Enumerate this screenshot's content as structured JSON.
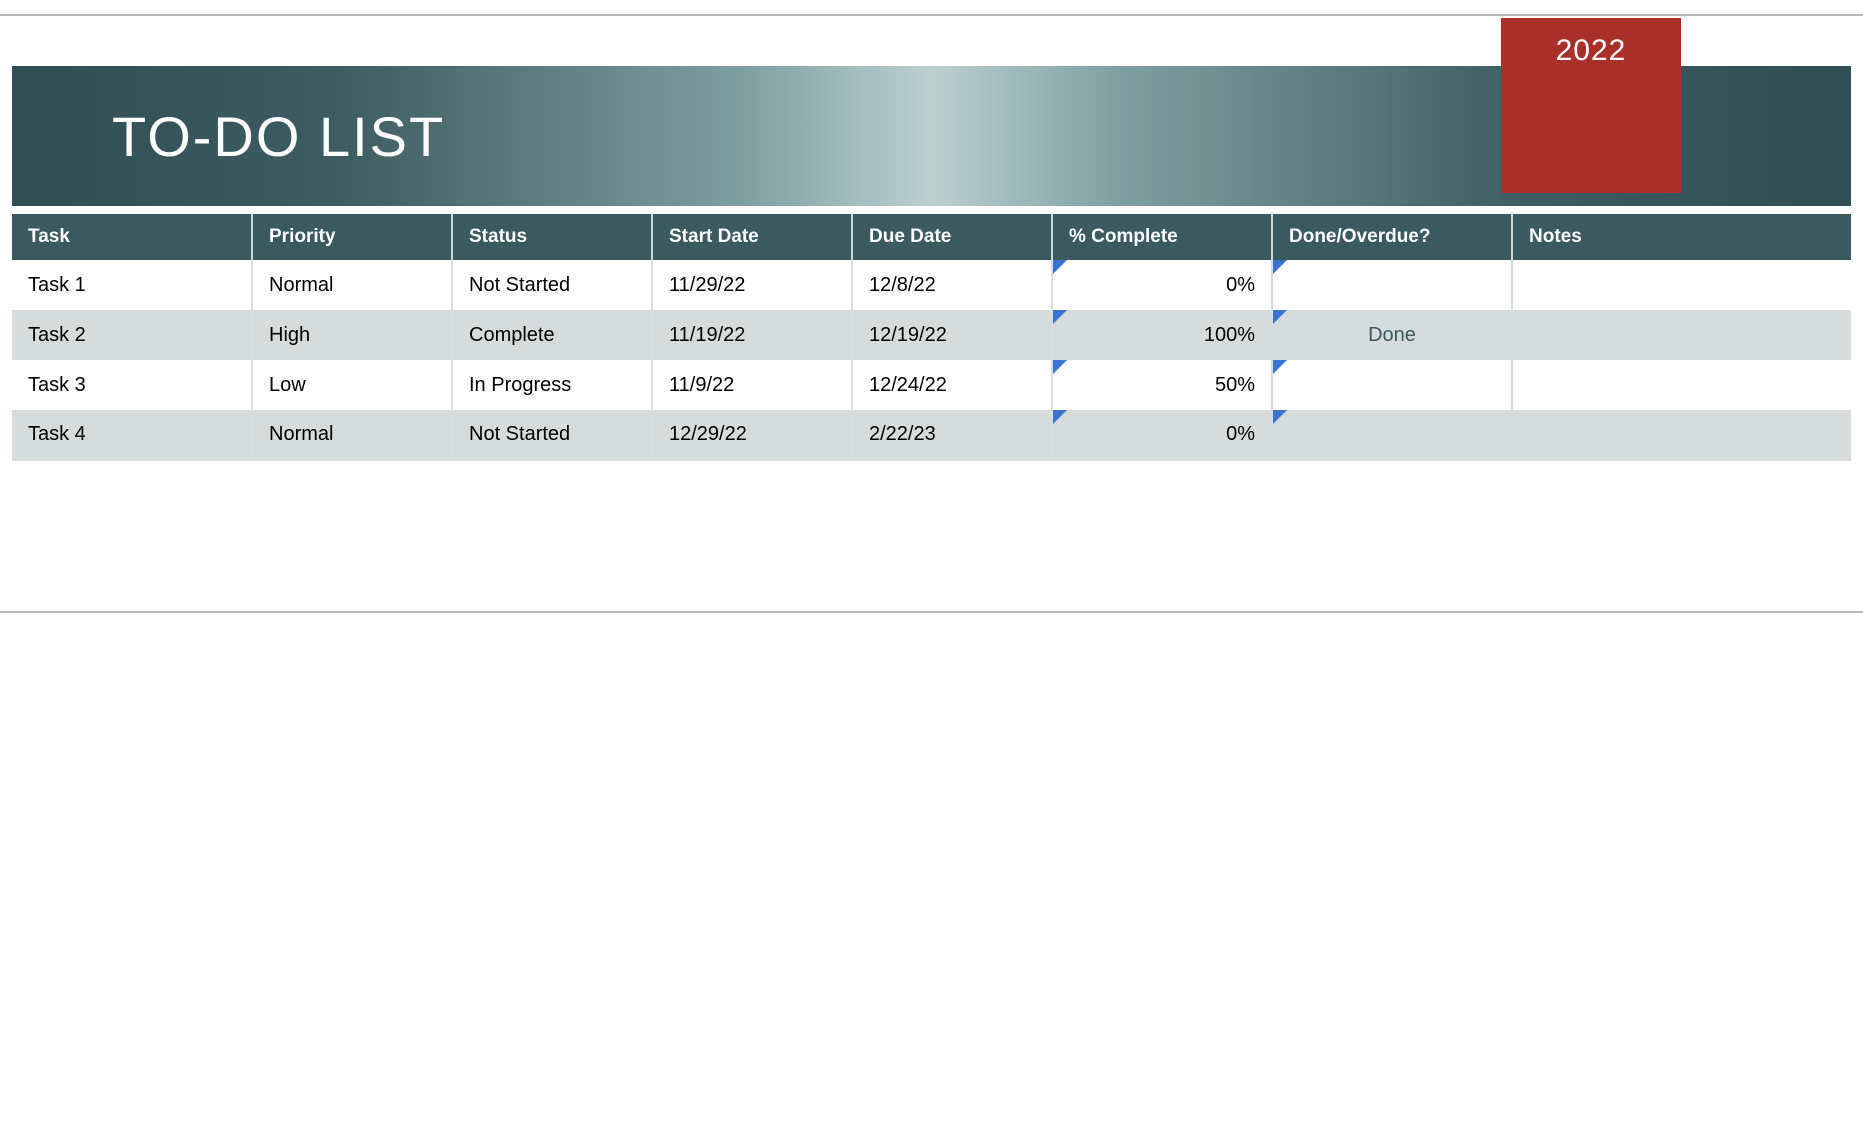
{
  "header": {
    "title": "TO-DO LIST",
    "year": "2022"
  },
  "table": {
    "columns": {
      "task": "Task",
      "priority": "Priority",
      "status": "Status",
      "start": "Start Date",
      "due": "Due Date",
      "pct": "% Complete",
      "done": "Done/Overdue?",
      "notes": "Notes"
    },
    "rows": [
      {
        "task": "Task 1",
        "priority": "Normal",
        "status": "Not Started",
        "start": "11/29/22",
        "due": "12/8/22",
        "pct": "0%",
        "done": "",
        "notes": ""
      },
      {
        "task": "Task 2",
        "priority": "High",
        "status": "Complete",
        "start": "11/19/22",
        "due": "12/19/22",
        "pct": "100%",
        "done": "Done",
        "notes": ""
      },
      {
        "task": "Task 3",
        "priority": "Low",
        "status": "In Progress",
        "start": "11/9/22",
        "due": "12/24/22",
        "pct": "50%",
        "done": "",
        "notes": ""
      },
      {
        "task": "Task 4",
        "priority": "Normal",
        "status": "Not Started",
        "start": "12/29/22",
        "due": "2/22/23",
        "pct": "0%",
        "done": "",
        "notes": ""
      }
    ]
  }
}
